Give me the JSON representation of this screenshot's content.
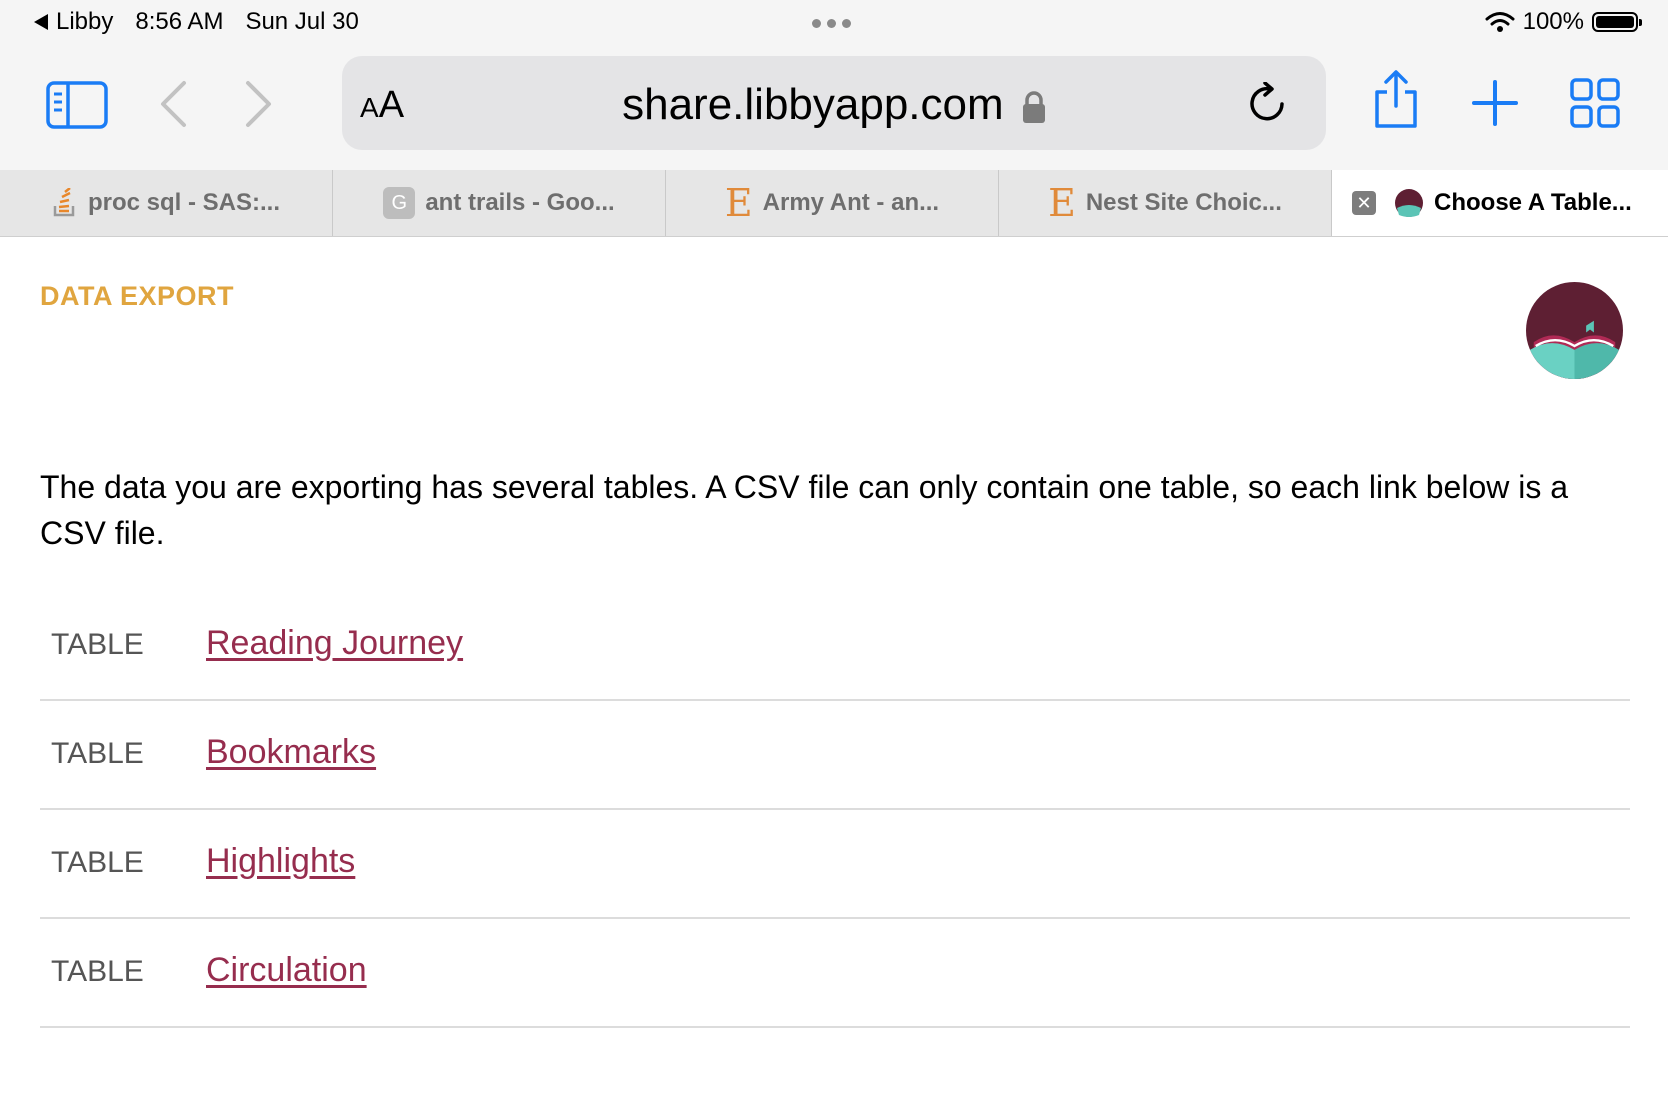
{
  "status_bar": {
    "back_app": "Libby",
    "time": "8:56 AM",
    "date": "Sun Jul 30",
    "battery": "100%"
  },
  "browser": {
    "text_size_label": "AA",
    "url": "share.libbyapp.com"
  },
  "tabs": [
    {
      "title": "proc sql - SAS:...",
      "icon": "stackoverflow-icon"
    },
    {
      "title": "ant trails - Goo...",
      "icon": "google-icon"
    },
    {
      "title": "Army Ant - an...",
      "icon": "encyclopedia-e-icon"
    },
    {
      "title": "Nest Site Choic...",
      "icon": "encyclopedia-e-icon"
    },
    {
      "title": "Choose A Table...",
      "icon": "libby-icon",
      "active": true
    }
  ],
  "page": {
    "section_label": "DATA EXPORT",
    "intro": "The data you are exporting has several tables. A CSV file can only contain one table, so each link below is a CSV file.",
    "tables": [
      {
        "label": "TABLE",
        "name": "Reading Journey"
      },
      {
        "label": "TABLE",
        "name": "Bookmarks"
      },
      {
        "label": "TABLE",
        "name": "Highlights"
      },
      {
        "label": "TABLE",
        "name": "Circulation"
      }
    ]
  },
  "colors": {
    "accent_link": "#962d4e",
    "section_label": "#e0a53f",
    "ios_blue": "#1a7cf5"
  }
}
